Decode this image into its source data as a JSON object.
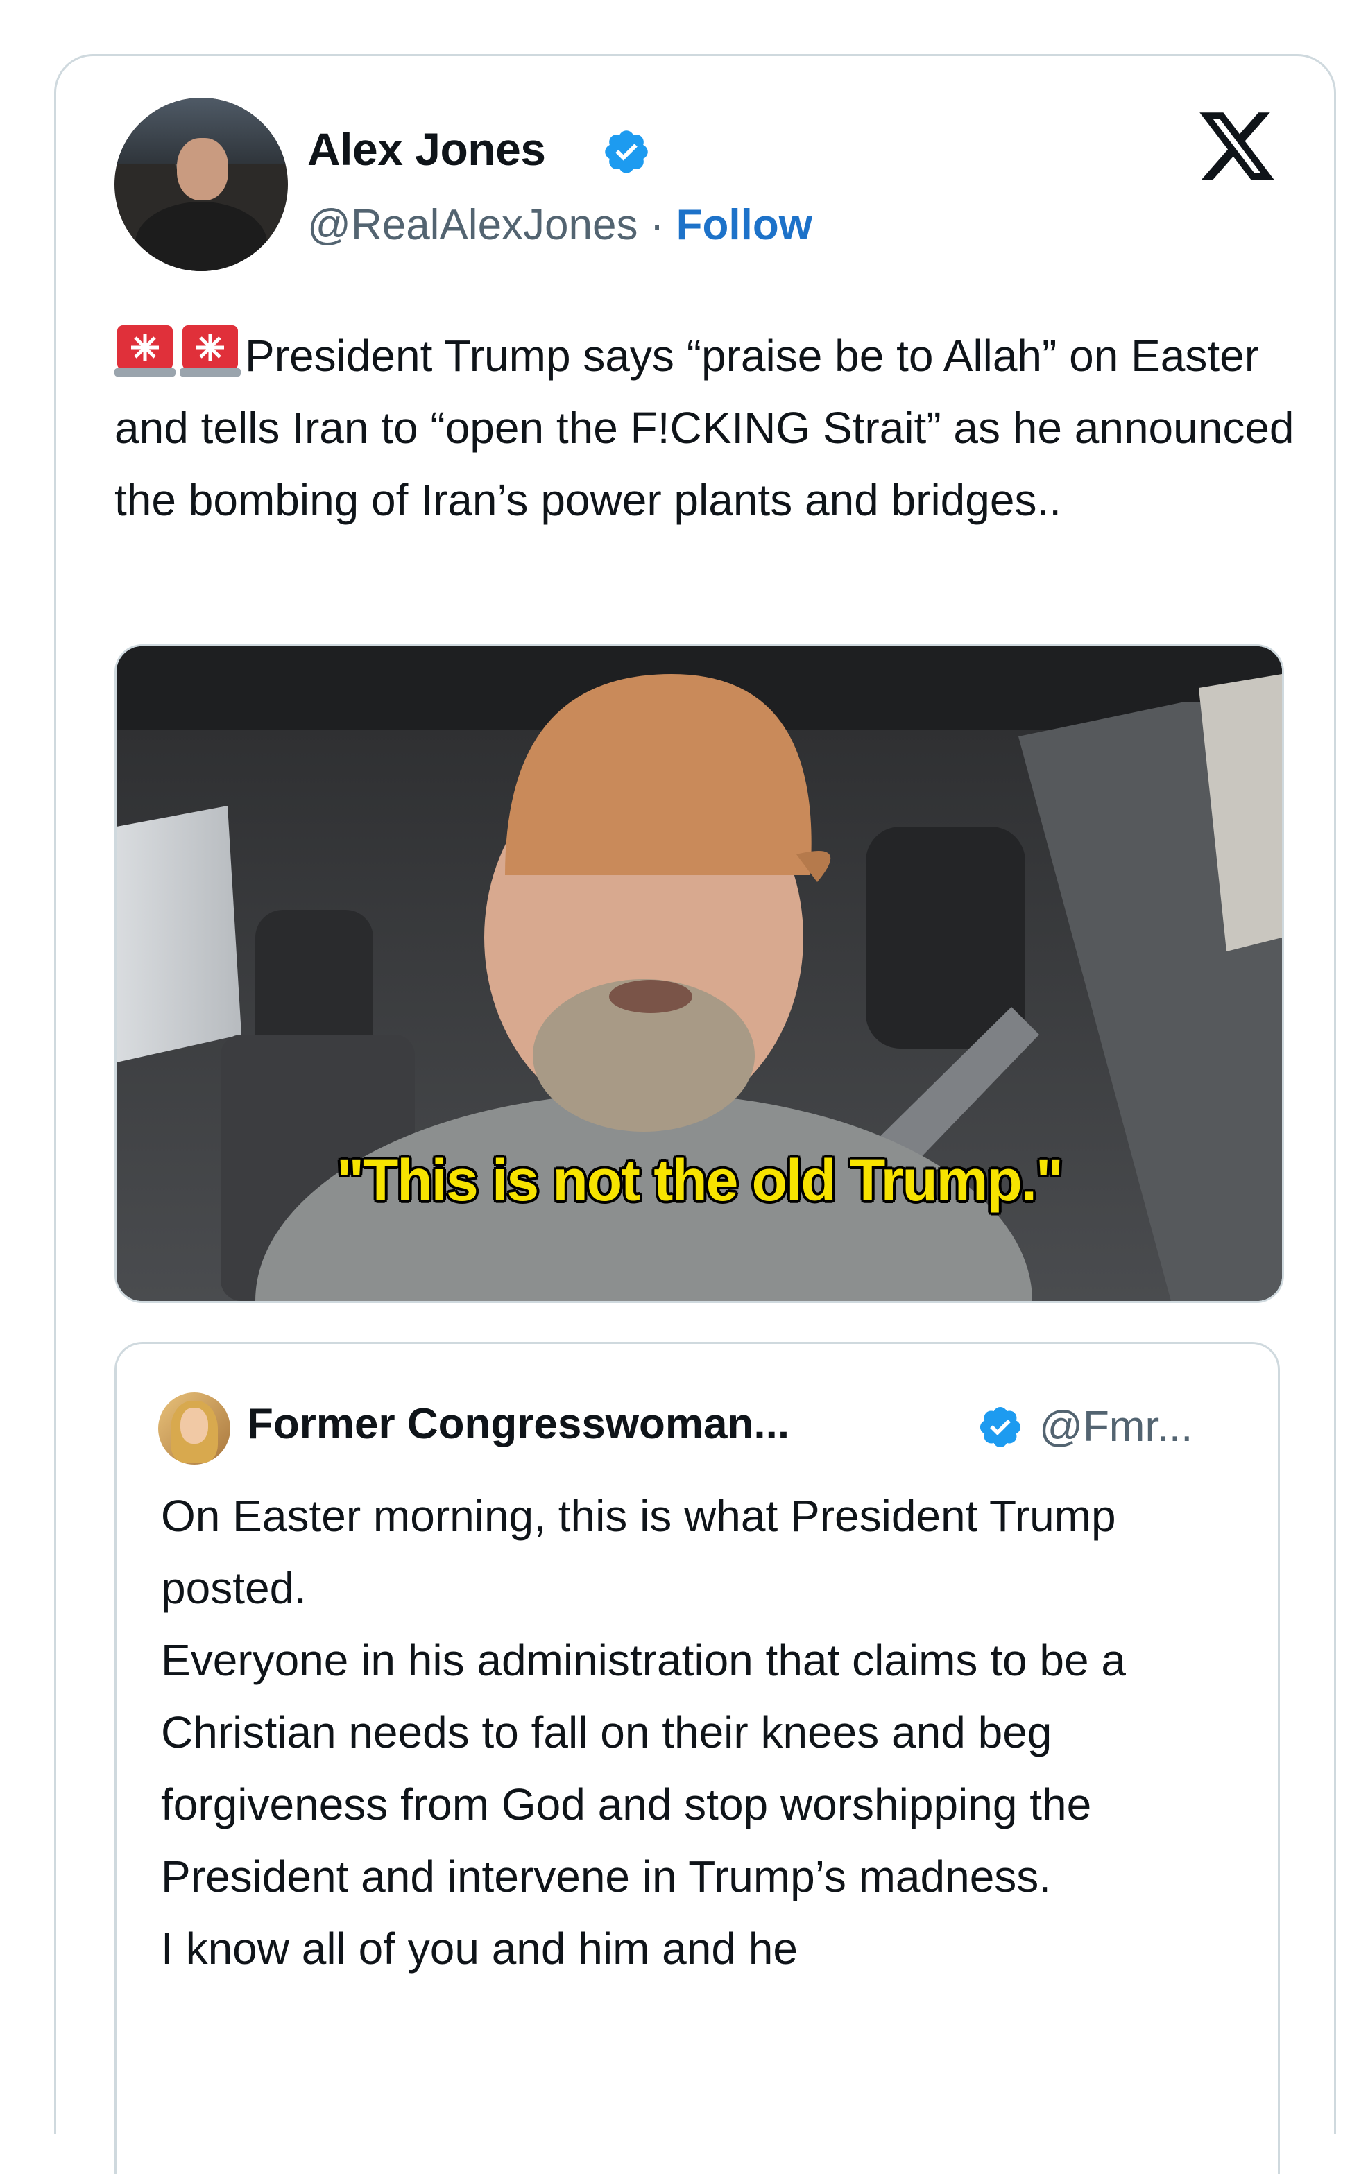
{
  "tweet": {
    "author_name": "Alex Jones",
    "handle": "@RealAlexJones",
    "separator": "·",
    "follow_label": "Follow",
    "verified_icon": "verified-badge-icon",
    "platform_icon": "x-logo-icon",
    "emoji": [
      "🚨",
      "🚨"
    ],
    "text": "President Trump says “praise be to Allah” on Easter and tells Iran to “open the F!CKING Strait” as he announced the bombing of Iran’s power plants and bridges.."
  },
  "media": {
    "caption": "\"This is not the old Trump.\""
  },
  "quoted_tweet": {
    "author_name": "Former Congresswoman...",
    "handle": "@Fmr...",
    "verified_icon": "verified-badge-icon",
    "lines": [
      "On Easter morning, this is what President Trump posted.",
      "Everyone in his administration that claims to be a Christian needs to fall on their knees and beg forgiveness from God and stop worshipping the President and intervene in Trump’s madness.",
      "I know all of you and him and he"
    ]
  },
  "colors": {
    "verified_blue": "#1d9bf0",
    "follow_blue": "#1d72c9",
    "caption_yellow": "#f7e300",
    "border": "#cfd9de",
    "secondary_text": "#536471"
  }
}
